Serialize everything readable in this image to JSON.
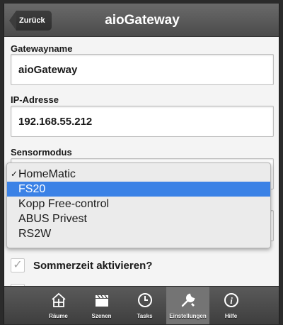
{
  "header": {
    "back_label": "Zurück",
    "title": "aioGateway"
  },
  "form": {
    "gateway_label": "Gatewayname",
    "gateway_value": "aioGateway",
    "ip_label": "IP-Adresse",
    "ip_value": "192.168.55.212",
    "sensor_label": "Sensormodus"
  },
  "dropdown": {
    "options": [
      "HomeMatic",
      "FS20",
      "Kopp Free-control",
      "ABUS Privest",
      "RS2W"
    ],
    "checked_index": 0,
    "highlighted_index": 1,
    "check_glyph": "✓"
  },
  "dst": {
    "label": "Sommerzeit aktivieren?",
    "checked": true,
    "check_glyph": "✓"
  },
  "tabs": [
    {
      "label": "Räume",
      "icon": "house-icon"
    },
    {
      "label": "Szenen",
      "icon": "clapperboard-icon"
    },
    {
      "label": "Tasks",
      "icon": "clock-icon"
    },
    {
      "label": "Einstellungen",
      "icon": "wrench-icon",
      "active": true
    },
    {
      "label": "Hilfe",
      "icon": "info-icon"
    }
  ],
  "colors": {
    "highlight": "#3b82e6",
    "header": "#5a5a5a",
    "active_tab": "#747474"
  }
}
